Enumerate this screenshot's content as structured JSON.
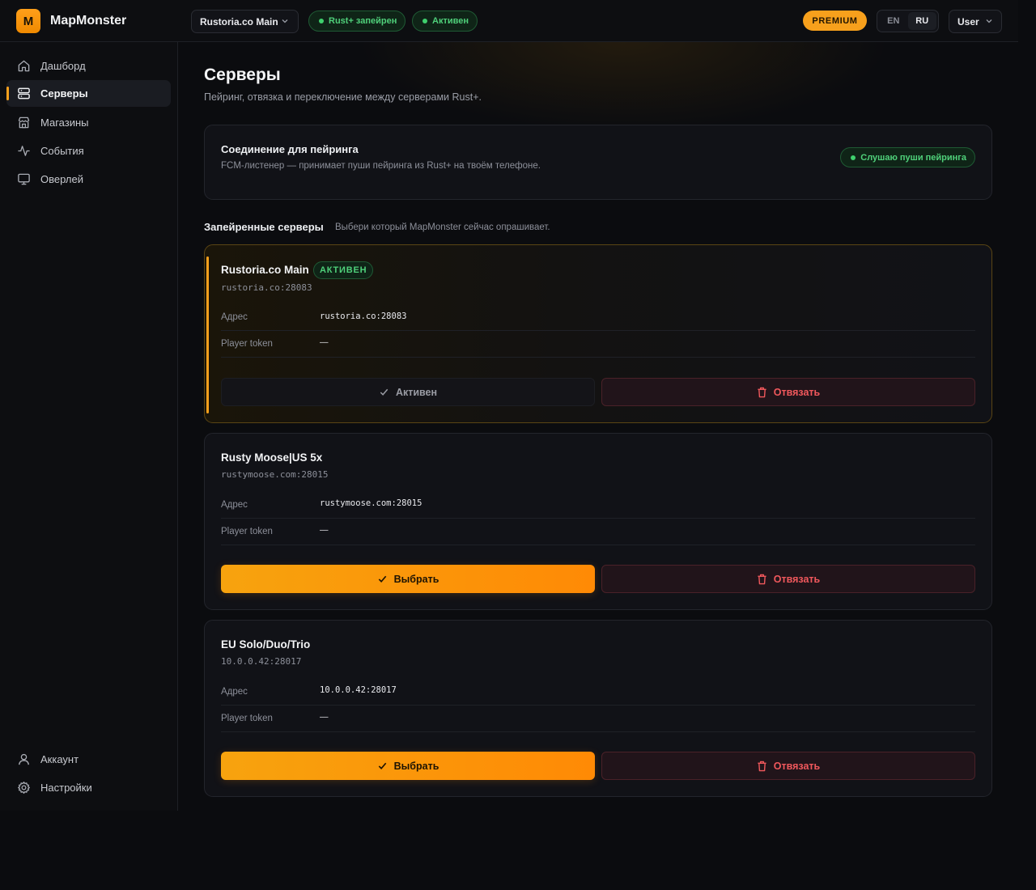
{
  "app": {
    "logo_letter": "M",
    "name": "MapMonster"
  },
  "topbar": {
    "server_select": "Rustoria.co Main",
    "status_paired": "Rust+ запейрен",
    "status_active": "Активен",
    "premium": "PREMIUM",
    "lang_en": "EN",
    "lang_ru": "RU",
    "user": "User"
  },
  "sidebar": {
    "items": [
      {
        "label": "Дашборд",
        "icon": "home-icon"
      },
      {
        "label": "Серверы",
        "icon": "server-icon"
      },
      {
        "label": "Магазины",
        "icon": "store-icon"
      },
      {
        "label": "События",
        "icon": "activity-icon"
      },
      {
        "label": "Оверлей",
        "icon": "monitor-icon"
      }
    ],
    "bottom": [
      {
        "label": "Аккаунт",
        "icon": "user-icon"
      },
      {
        "label": "Настройки",
        "icon": "gear-icon"
      }
    ]
  },
  "page": {
    "title": "Серверы",
    "subtitle": "Пейринг, отвязка и переключение между серверами Rust+."
  },
  "fcm": {
    "title": "Соединение для пейринга",
    "subtitle": "FCM-листенер — принимает пуши пейринга из Rust+ на твоём телефоне.",
    "status": "Слушаю пуши пейринга"
  },
  "paired": {
    "title": "Запейренные серверы",
    "hint": "Выбери который MapMonster сейчас опрашивает."
  },
  "labels": {
    "address": "Адрес",
    "player_token": "Player token",
    "active_button": "Активен",
    "select_button": "Выбрать",
    "unlink_button": "Отвязать",
    "active_badge": "АКТИВЕН"
  },
  "servers": [
    {
      "name": "Rustoria.co Main",
      "host": "rustoria.co:28083",
      "address": "rustoria.co:28083",
      "token": "—",
      "active": true
    },
    {
      "name": "Rusty Moose|US 5x",
      "host": "rustymoose.com:28015",
      "address": "rustymoose.com:28015",
      "token": "—",
      "active": false
    },
    {
      "name": "EU Solo/Duo/Trio",
      "host": "10.0.0.42:28017",
      "address": "10.0.0.42:28017",
      "token": "—",
      "active": false
    }
  ],
  "colors": {
    "accent": "#f7a01c",
    "success": "#4fd07a",
    "danger": "#f0585c",
    "background": "#0b0c0f"
  }
}
